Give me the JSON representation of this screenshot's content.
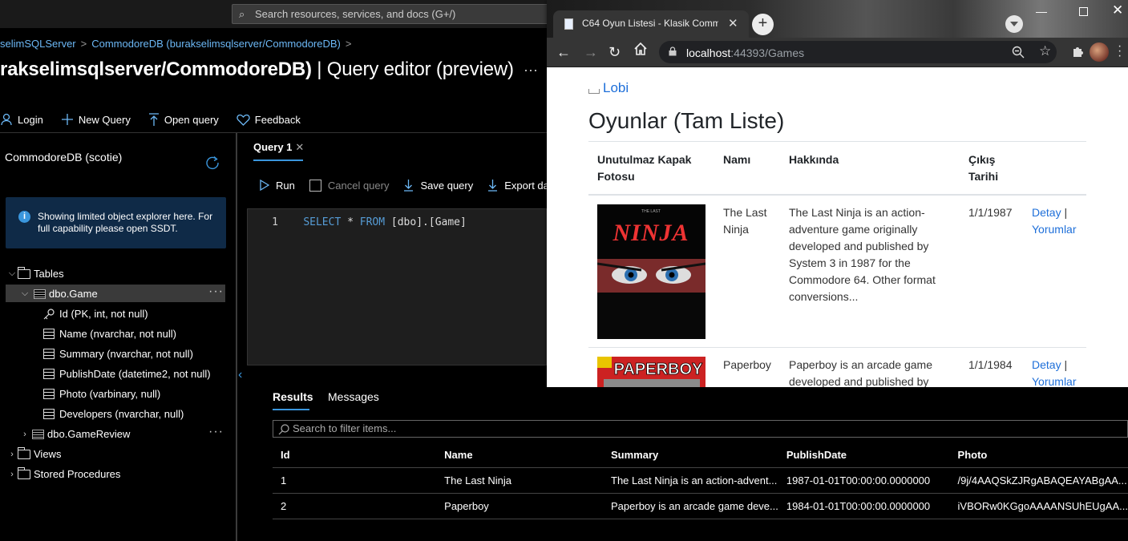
{
  "azure": {
    "search_placeholder": "Search resources, services, and docs (G+/)",
    "breadcrumb": [
      "selimSQLServer",
      "CommodoreDB (burakselimsqlserver/CommodoreDB)"
    ],
    "title_bold": "rakselimsqlserver/CommodoreDB)",
    "title_rest": " | Query editor (preview)",
    "title_more": "···",
    "toolbar": {
      "login": "Login",
      "new_query": "New Query",
      "open_query": "Open query",
      "feedback": "Feedback"
    },
    "explorer": {
      "db_name": "CommodoreDB (scotie)",
      "info_text": "Showing limited object explorer here. For full capability please open SSDT.",
      "tables_label": "Tables",
      "game_table": "dbo.Game",
      "columns": [
        "Id (PK, int, not null)",
        "Name (nvarchar, not null)",
        "Summary (nvarchar, not null)",
        "PublishDate (datetime2, not null)",
        "Photo (varbinary, null)",
        "Developers (nvarchar, null)"
      ],
      "review_table": "dbo.GameReview",
      "views_label": "Views",
      "procs_label": "Stored Procedures",
      "more": "···"
    },
    "editor": {
      "tab_label": "Query 1",
      "tab_close": "✕",
      "run": "Run",
      "cancel": "Cancel query",
      "save": "Save query",
      "export": "Export da",
      "line_no": "1",
      "code_kw1": "SELECT",
      "code_star": " * ",
      "code_kw2": "FROM",
      "code_rest": " [dbo].[Game]"
    },
    "results": {
      "tab_results": "Results",
      "tab_messages": "Messages",
      "filter_placeholder": "Search to filter items...",
      "columns": [
        "Id",
        "Name",
        "Summary",
        "PublishDate",
        "Photo"
      ],
      "rows": [
        [
          "1",
          "The Last Ninja",
          "The Last Ninja is an action-advent...",
          "1987-01-01T00:00:00.0000000",
          "/9j/4AAQSkZJRgABAQEAYABgAA..."
        ],
        [
          "2",
          "Paperboy",
          "Paperboy is an arcade game deve...",
          "1984-01-01T00:00:00.0000000",
          "iVBORw0KGgoAAAANSUhEUgAA..."
        ]
      ]
    }
  },
  "browser": {
    "tab_title": "C64 Oyun Listesi - Klasik Commo",
    "url_host": "localhost",
    "url_rest": ":44393/Games",
    "page": {
      "lobi_link": "Lobi",
      "heading": "Oyunlar (Tam Liste)",
      "columns": [
        "Unutulmaz Kapak Fotosu",
        "Namı",
        "Hakkında",
        "Çıkış Tarihi",
        ""
      ],
      "games": [
        {
          "name": "The Last Ninja",
          "summary": "The Last Ninja is an action-adventure game originally developed and published by System 3 in 1987 for the Commodore 64. Other format conversions...",
          "date": "1/1/1987",
          "detail": "Detay",
          "sep": " | ",
          "comments": "Yorumlar",
          "cover_logo": "NINJA",
          "cover_top": "THE LAST"
        },
        {
          "name": "Paperboy",
          "summary": "Paperboy is an arcade game developed and published by",
          "date": "1/1/1984",
          "detail": "Detay",
          "sep": " | ",
          "comments": "Yorumlar",
          "cover_logo": "PAPERBOY"
        }
      ]
    }
  },
  "colors": {
    "azure_link": "#6cb8f6",
    "azure_accent": "#3a96dd",
    "page_link": "#1e6fd9"
  }
}
